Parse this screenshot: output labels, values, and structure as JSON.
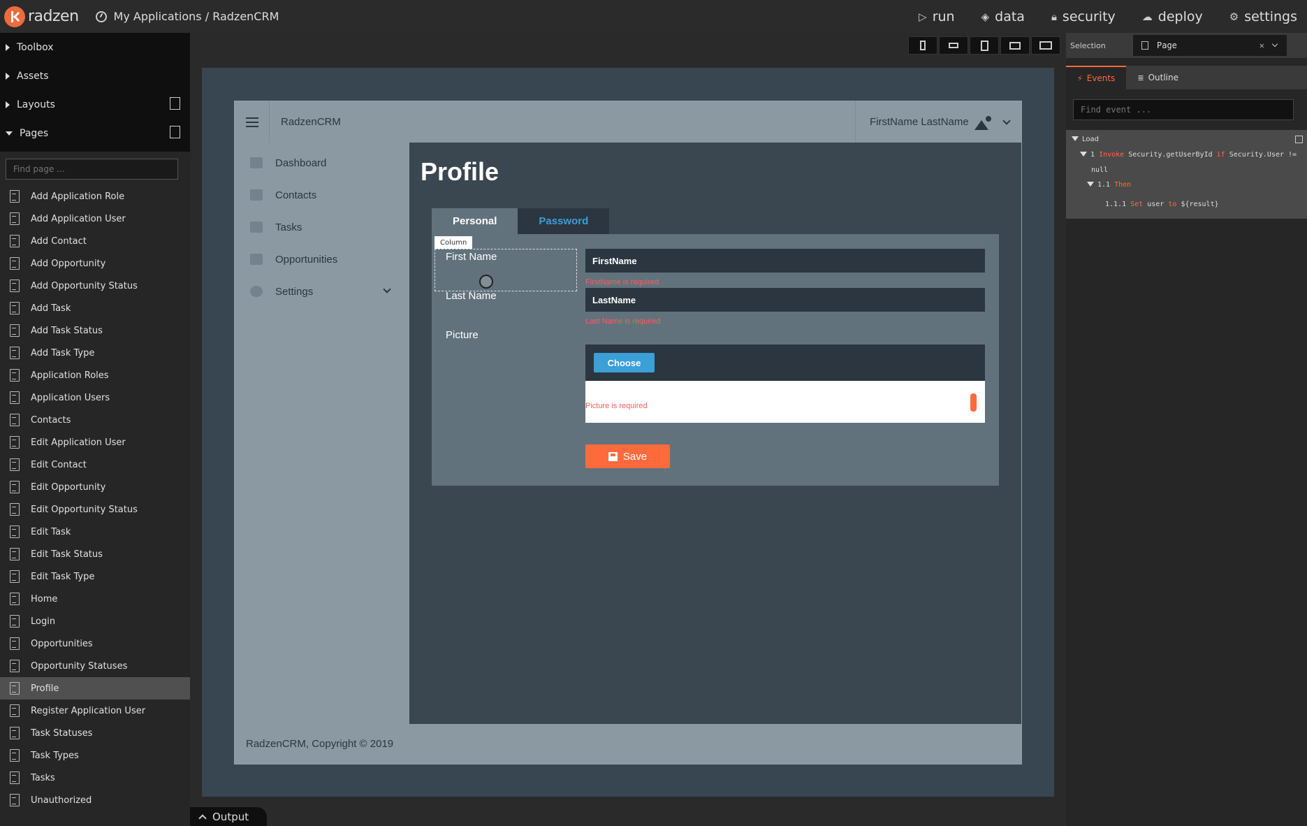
{
  "topbar": {
    "logo_text": "radzen",
    "breadcrumb": "My Applications / RadzenCRM",
    "nav": [
      {
        "icon": "play-icon",
        "glyph": "▷",
        "label": "run"
      },
      {
        "icon": "layers-icon",
        "glyph": "◈",
        "label": "data"
      },
      {
        "icon": "lock-icon",
        "glyph": "🔒︎",
        "label": "security"
      },
      {
        "icon": "cloud-upload-icon",
        "glyph": "☁",
        "label": "deploy"
      },
      {
        "icon": "gear-icon",
        "glyph": "⚙",
        "label": "settings"
      }
    ]
  },
  "left_panel": {
    "sections": {
      "toolbox": "Toolbox",
      "assets": "Assets",
      "layouts": "Layouts",
      "pages": "Pages"
    },
    "search_placeholder": "Find page ...",
    "pages": [
      "Add Application Role",
      "Add Application User",
      "Add Contact",
      "Add Opportunity",
      "Add Opportunity Status",
      "Add Task",
      "Add Task Status",
      "Add Task Type",
      "Application Roles",
      "Application Users",
      "Contacts",
      "Edit Application User",
      "Edit Contact",
      "Edit Opportunity",
      "Edit Opportunity Status",
      "Edit Task",
      "Edit Task Status",
      "Edit Task Type",
      "Home",
      "Login",
      "Opportunities",
      "Opportunity Statuses",
      "Profile",
      "Register Application User",
      "Task Statuses",
      "Task Types",
      "Tasks",
      "Unauthorized"
    ],
    "active_page": "Profile",
    "output_label": "Output"
  },
  "preview": {
    "app_title": "RadzenCRM",
    "user_name": "FirstName LastName",
    "sidebar": [
      {
        "icon": "home-icon",
        "label": "Dashboard"
      },
      {
        "icon": "contacts-icon",
        "label": "Contacts"
      },
      {
        "icon": "briefcase-icon",
        "label": "Tasks"
      },
      {
        "icon": "cart-icon",
        "label": "Opportunities"
      },
      {
        "icon": "settings-icon",
        "label": "Settings"
      }
    ],
    "footer": "RadzenCRM, Copyright © 2019",
    "page_title": "Profile",
    "tabs": {
      "personal": "Personal",
      "password": "Password"
    },
    "selection_tag": "Column",
    "form": {
      "first_name_label": "First Name",
      "first_name_value": "FirstName",
      "first_name_error": "FirstName is required",
      "last_name_label": "Last Name",
      "last_name_value": "LastName",
      "last_name_error": "Last Name is required",
      "picture_label": "Picture",
      "choose_label": "Choose",
      "picture_error": "Picture is required",
      "save_label": "Save"
    }
  },
  "right_panel": {
    "selection_label": "Selection",
    "selection_value": "Page",
    "tabs": {
      "events": "Events",
      "outline": "Outline"
    },
    "find_event_placeholder": "Find event ...",
    "events": {
      "load": "Load",
      "step1_num": "1",
      "step1_action": "Invoke",
      "step1_method": "Security.getUserById",
      "step1_if": "if",
      "step1_cond": "Security.User !=",
      "step1_cond2": "null",
      "step11_num": "1.1",
      "step11_then": "Then",
      "step111_num": "1.1.1",
      "step111_set": "Set",
      "step111_var": "user",
      "step111_to": "to",
      "step111_val": "${result}"
    }
  },
  "colors": {
    "accent": "#ff6a3d",
    "link": "#3b9fd8",
    "error": "#ff5b5b"
  }
}
